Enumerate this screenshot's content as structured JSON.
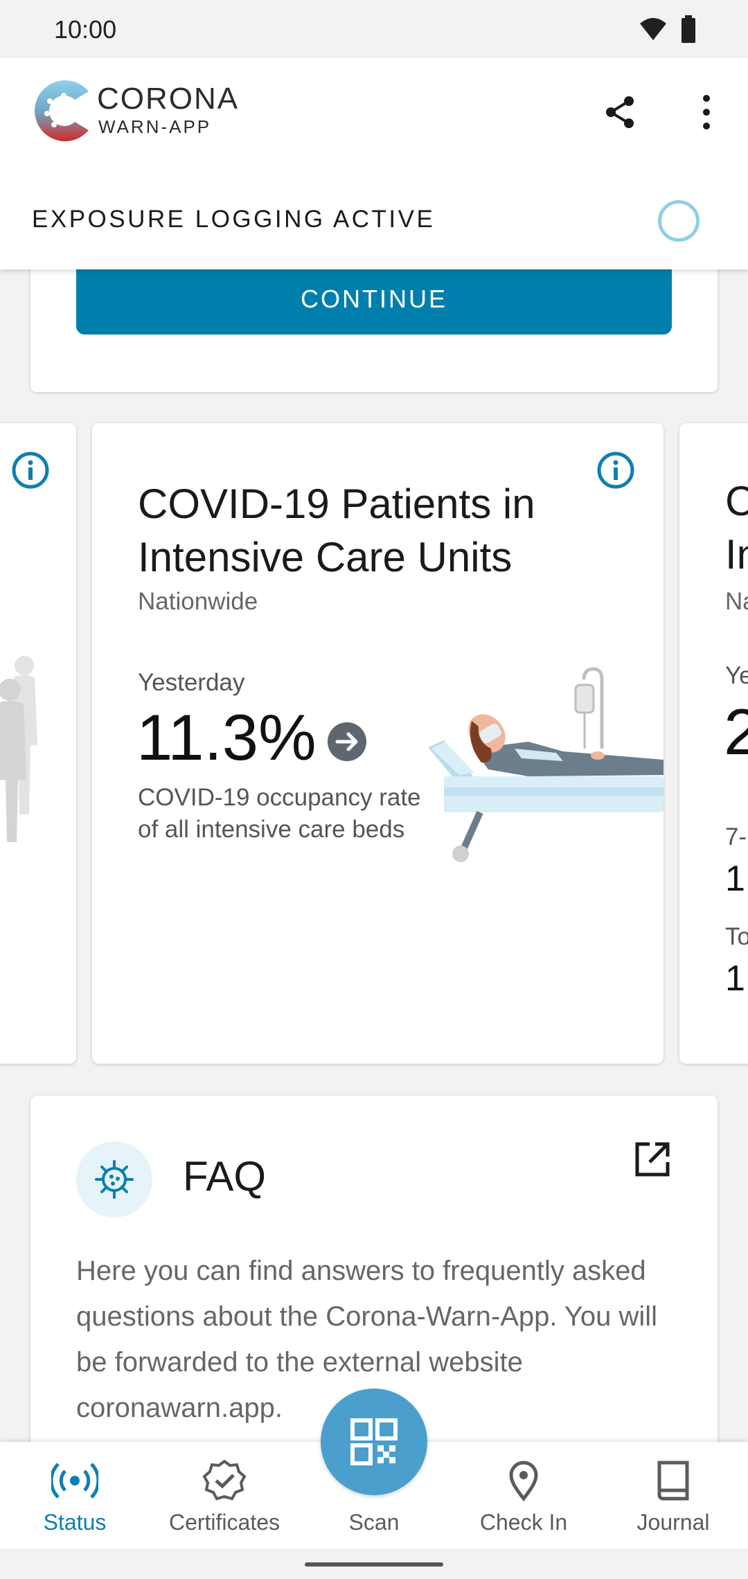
{
  "status_bar": {
    "time": "10:00"
  },
  "app_bar": {
    "brand_line1": "CORONA",
    "brand_line2": "WARN-APP"
  },
  "exposure": {
    "label": "EXPOSURE LOGGING ACTIVE"
  },
  "top_card": {
    "continue_label": "CONTINUE"
  },
  "stats_main": {
    "title": "COVID-19 Patients in Intensive Care Units",
    "subtitle": "Nationwide",
    "period": "Yesterday",
    "value": "11.3%",
    "description": "COVID-19 occupancy rate of all intensive care beds"
  },
  "stats_right_peek": {
    "title_lines": [
      "C",
      "In"
    ],
    "subtitle": "Na",
    "period": "Ye",
    "value": "2",
    "row2_label": "7-",
    "row2_value": "1",
    "row3_label": "To",
    "row3_value": "1"
  },
  "faq": {
    "title": "FAQ",
    "text": "Here you can find answers to frequently asked questions about the Corona-Warn-App. You will be forwarded to the external website coronawarn.app."
  },
  "bottom_nav": {
    "status": "Status",
    "certificates": "Certificates",
    "scan": "Scan",
    "check_in": "Check In",
    "journal": "Journal"
  },
  "colors": {
    "primary": "#007fad",
    "active_nav": "#0d7fb0",
    "scan_fab": "#4a9fcc",
    "ring": "#8fcfe6"
  }
}
